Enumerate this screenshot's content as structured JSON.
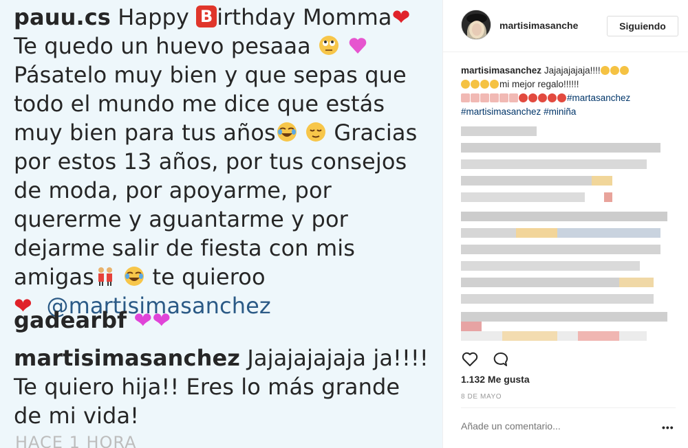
{
  "comments": {
    "c1": {
      "user": "pauu.cs",
      "t1": "Happy",
      "b_letter": "B",
      "t2": "irthday Momma",
      "t3": "Te quedo un huevo pesaaa",
      "t4": "Pásatelo muy bien y que sepas que todo el mundo me dice que estás muy bien para tus años",
      "t5": "Gracias por estos 13 años, por tus consejos de moda, por apoyarme, por quererme y aguantarme y por dejarme salir de fiesta con mis amigas",
      "t6": "te quieroo",
      "mention": "@martisimasanchez"
    },
    "c2": {
      "user": "gadearbf"
    },
    "c3": {
      "user": "martisimasanchez",
      "text": "Jajajajajaja ja!!!! Te quiero hija!! Eres lo más grande de mi vida!"
    },
    "time": "HACE 1 HORA"
  },
  "post": {
    "username": "martisimasanche",
    "follow_label": "Siguiendo",
    "caption": {
      "user": "martisimasanchez",
      "text1": "Jajajajajaja!!!!",
      "text2": "mi mejor regalo!!!!!!",
      "tag1": "#martasanchez",
      "tag2": "#martisimasanchez",
      "tag3": "#miniña"
    },
    "likes": "1.132 Me gusta",
    "date": "8 DE MAYO",
    "comment_placeholder": "Añade un comentario...",
    "more": "•••"
  },
  "icons": {
    "heart": "heart-outline-icon",
    "comment": "comment-bubble-icon",
    "more": "more-options-icon"
  },
  "colors": {
    "left_bg": "#eef7fb",
    "mention": "#2b5a86",
    "hashtag": "#003569"
  }
}
